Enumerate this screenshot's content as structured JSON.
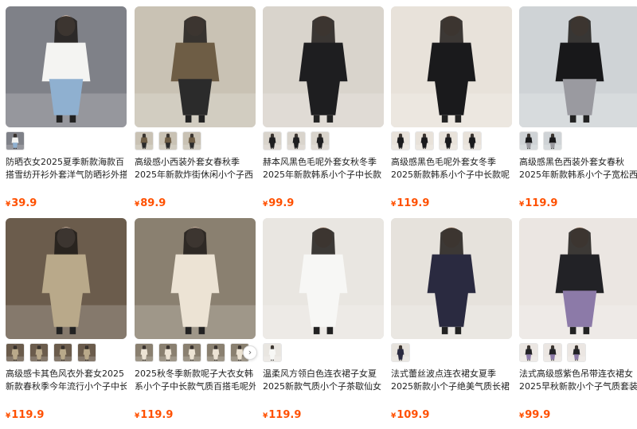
{
  "currency": "¥",
  "products": [
    {
      "title_l1": "防晒衣女2025夏季新款海款百",
      "title_l2": "搭雪纺开衫外套洋气防晒衫外搭",
      "price": "39.9",
      "thumbs": 1,
      "colors": {
        "bg": "#7f8188",
        "top": "#f4f4f2",
        "bottom": "#8fb0d0"
      }
    },
    {
      "title_l1": "高级感小西装外套女春秋季",
      "title_l2": "2025年新款炸街休闲小个子西",
      "price": "89.9",
      "thumbs": 3,
      "colors": {
        "bg": "#c9c2b4",
        "top": "#6e5d45",
        "bottom": "#2b2b2b"
      }
    },
    {
      "title_l1": "赫本风黑色毛呢外套女秋冬季",
      "title_l2": "2025年新款韩系小个子中长款",
      "price": "99.9",
      "thumbs": 3,
      "colors": {
        "bg": "#d9d4cc",
        "top": "#1e1e20",
        "bottom": "#1e1e20"
      }
    },
    {
      "title_l1": "高级感黑色毛呢外套女冬季",
      "title_l2": "2025新款韩系小个子中长款呢",
      "price": "119.9",
      "thumbs": 4,
      "colors": {
        "bg": "#e8e2da",
        "top": "#1a1a1c",
        "bottom": "#1a1a1c"
      }
    },
    {
      "title_l1": "高级感黑色西装外套女春秋",
      "title_l2": "2025年新款韩系小个子宽松西",
      "price": "119.9",
      "thumbs": 2,
      "colors": {
        "bg": "#cfd3d6",
        "top": "#18181a",
        "bottom": "#9a9aa0"
      }
    },
    {
      "title_l1": "高级感卡其色风衣外套女2025",
      "title_l2": "新款春秋季今年流行小个子中长",
      "price": "119.9",
      "thumbs": 4,
      "colors": {
        "bg": "#6b5c4c",
        "top": "#b9a98a",
        "bottom": "#b9a98a"
      }
    },
    {
      "title_l1": "2025秋冬季新款呢子大衣女韩",
      "title_l2": "系小个子中长款气质百搭毛呢外",
      "price": "119.9",
      "thumbs": 5,
      "colors": {
        "bg": "#8a8070",
        "top": "#ece3d4",
        "bottom": "#ece3d4"
      }
    },
    {
      "title_l1": "温柔风方领白色连衣裙子女夏",
      "title_l2": "2025新款气质小个子茶歇仙女",
      "price": "119.9",
      "thumbs": 1,
      "colors": {
        "bg": "#e9e6e1",
        "top": "#f7f7f5",
        "bottom": "#f7f7f5"
      }
    },
    {
      "title_l1": "法式蕾丝波点连衣裙女夏季",
      "title_l2": "2025新款小个子绝美气质长裙",
      "price": "109.9",
      "thumbs": 1,
      "colors": {
        "bg": "#e6e2dc",
        "top": "#2a2a40",
        "bottom": "#2a2a40"
      }
    },
    {
      "title_l1": "法式高级感紫色吊带连衣裙女",
      "title_l2": "2025早秋新款小个子气质套装",
      "price": "99.9",
      "thumbs": 3,
      "colors": {
        "bg": "#ebe6e2",
        "top": "#222226",
        "bottom": "#8c7aa8"
      }
    }
  ],
  "carousel_next": "›"
}
